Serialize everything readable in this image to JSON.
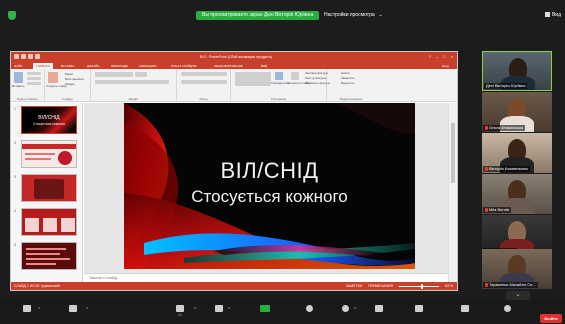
{
  "zoom_top": {
    "share_banner": "Вы просматриваете экран Дехі Вікторія Юріївна",
    "view_options": "Настройки просмотра",
    "view_options_chevron": "⌄",
    "view_label": "Вид"
  },
  "ppt": {
    "title": "ВІЛ - PowerPoint (Сбой активации продукта)",
    "tabs": [
      "ФАЙЛ",
      "ГЛАВНАЯ",
      "ВСТАВКА",
      "ДИЗАЙН",
      "ПЕРЕХОДЫ",
      "АНИМАЦИЯ",
      "ПОКАЗ СЛАЙДОВ",
      "РЕЦЕНЗИРОВАНИЕ",
      "ВИД"
    ],
    "sign_in": "Вход",
    "ribbon": {
      "groups": [
        "Буфер обмена",
        "Слайды",
        "Шрифт",
        "Абзац",
        "Рисование",
        "Редактирование"
      ],
      "paste": "Вставить",
      "create_slide": "Создать слайд",
      "layout": "Макет",
      "reset": "Восстановить",
      "section": "Раздел",
      "arrange": "Упорядочить",
      "styles": "Экспресс-стили",
      "fill": "Заливка фигуры",
      "outline": "Контур фигуры",
      "effects": "Эффекты фигуры",
      "find": "Найти",
      "replace": "Заменить",
      "select": "Выделить"
    },
    "thumb1_title": "ВІЛ/СНІД",
    "thumb1_sub": "Стосується кожного",
    "slide_title": "ВІЛ/СНІД",
    "slide_subtitle": "Стосується кожного",
    "notes_placeholder": "Заметки к слайду",
    "status_left": "СЛАЙД 1 ИЗ 30",
    "status_lang": "украинский",
    "status_notes": "ЗАМЕТКИ",
    "status_comments": "ПРИМЕЧАНИЯ",
    "zoom_pct": "63 %"
  },
  "participants": [
    {
      "name": "Дехі Вікторія Юріївна",
      "speaking": true
    },
    {
      "name": "Ольга Атаманська",
      "speaking": false
    },
    {
      "name": "Вікторія Кожевнікова",
      "speaking": false
    },
    {
      "name": "Mila Bunda",
      "speaking": false
    },
    {
      "name": "Ужвак Альона",
      "speaking": false
    },
    {
      "name": "Тарасенко Михайло Се...",
      "speaking": false
    }
  ],
  "zoom_bottom": {
    "participants_count": "41",
    "leave": "Выйти"
  },
  "colors": {
    "ppt_accent": "#c8402c",
    "zoom_green": "#27ae3f",
    "leave_red": "#e0322f"
  }
}
